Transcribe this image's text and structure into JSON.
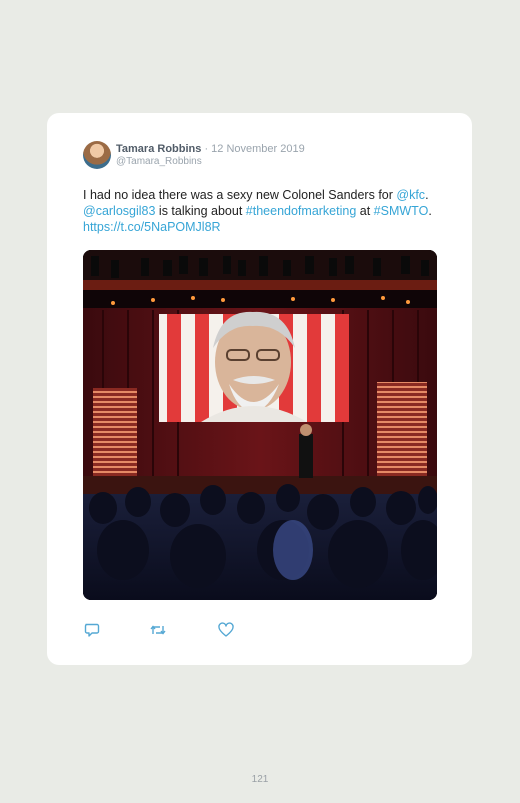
{
  "tweet": {
    "author_name": "Tamara Robbins",
    "separator": "·",
    "date": "12 November 2019",
    "handle": "@Tamara_Robbins",
    "text_part1": "I had no idea there was a sexy new Colonel Sanders for ",
    "mention_kfc": "@kfc",
    "text_part2": ". ",
    "mention_carlos": "@carlosgil83",
    "text_part3": " is talking about ",
    "hashtag_end": "#theendofmarketing",
    "text_part4": " at ",
    "hashtag_smwto": "#SMWTO",
    "text_part5": ". ",
    "url": "https://t.co/5NaPOMJl8R"
  },
  "actions": {
    "reply_icon": "reply-icon",
    "retweet_icon": "retweet-icon",
    "like_icon": "heart-icon"
  },
  "colors": {
    "link": "#36a5d6",
    "page_background": "#e9ebe6",
    "card": "#ffffff"
  },
  "page_number": "121"
}
